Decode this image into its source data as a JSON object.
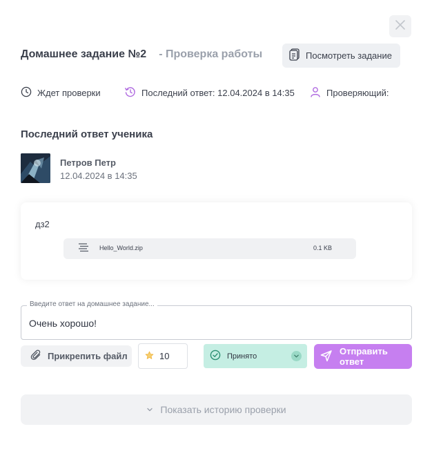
{
  "header": {
    "title": "Домашнее задание №2",
    "subtitle": "- Проверка работы",
    "view_task_label": "Посмотреть задание"
  },
  "status": {
    "state": "Ждет проверки",
    "last_answer": "Последний ответ: 12.04.2024 в 14:35",
    "reviewer": "Проверяющий:"
  },
  "last_answer": {
    "section_title": "Последний ответ ученика",
    "student_name": "Петров Петр",
    "timestamp": "12.04.2024 в 14:35",
    "text": "дз2",
    "file": {
      "name": "Hello_World.zip",
      "size": "0.1 KB"
    }
  },
  "reply": {
    "label": "Введите ответ на домашнее задание...",
    "value": "Очень хорошо!",
    "attach_label": "Прикрепить файл",
    "score": "10",
    "status_value": "Принято",
    "send_label": "Отправить ответ"
  },
  "history": {
    "label": "Показать историю проверки"
  },
  "icons": {
    "close": "close-icon",
    "document": "document-icon",
    "clock": "clock-icon",
    "history": "history-icon",
    "user": "user-icon",
    "file": "file-lines-icon",
    "paperclip": "paperclip-icon",
    "star": "star-icon",
    "check": "check-circle-icon",
    "chevron": "chevron-down-icon",
    "send": "send-icon"
  },
  "colors": {
    "accent": "#c67ff0",
    "accepted_bg": "#c5eee3",
    "history_icon": "#b06be0",
    "star": "#f0b43c"
  }
}
